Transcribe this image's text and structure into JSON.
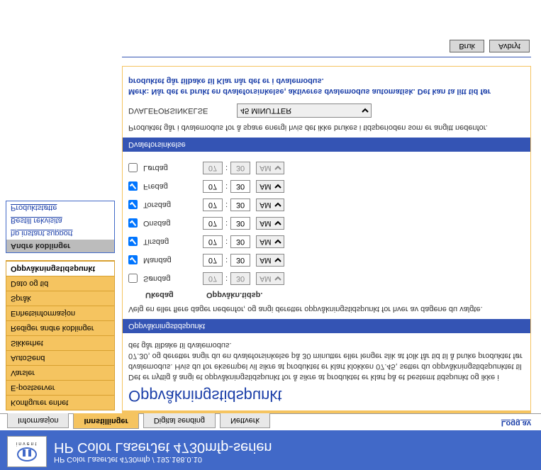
{
  "header": {
    "sub": "HP Color LaserJet 4730mfp / 192.168.0.10",
    "main": "HP Color LaserJet 4730mfp-serien",
    "logo_invent": "invent"
  },
  "tabs": {
    "info": "Informasjon",
    "settings": "Innstillinger",
    "digital": "Digital sending",
    "network": "Nettverk",
    "logoff": "Logg av"
  },
  "nav": {
    "items": [
      "Konfigurer enhet",
      "E-postserver",
      "Varsler",
      "AutoSend",
      "Sikkerhet",
      "Rediger andre koblinger",
      "Enhetsinformasjon",
      "Språk",
      "Dato og tid",
      "Oppvåkningstidspunkt"
    ]
  },
  "links": {
    "head": "Andre koblinger",
    "a": "hp instant support",
    "b": "Bestill rekvisita",
    "c": "Produktstøtte"
  },
  "page": {
    "title": "Oppvåkningstidspunkt",
    "intro": "Det er nyttig å angi et oppvåkningstidspunkt for å sikre at produktet er klart på et bestemt tidspunkt og ikke i dvalemodus. Hvis du for eksempel vil sikre at produktet er klart klokken 07.45, setter du oppvåkningstidspunktet til 07.30, og deretter angir du en dvaleforsinkelse på 30 minutter eller lenger slik at folk får tid til å bruke produktet før det går tilbake til dvalemodus.",
    "section1": "Oppvåkningstidspunkt",
    "section1_text": "Velg en eller flere dager nedenfor, og angi deretter oppvåkningstidspunkt for hver av dagene du valgte.",
    "col_day": "Ukedag",
    "col_time": "Oppvåkn.tidsp.",
    "days": [
      {
        "name": "Søndag",
        "checked": false,
        "h": "07",
        "m": "30",
        "ap": "AM"
      },
      {
        "name": "Mandag",
        "checked": true,
        "h": "07",
        "m": "30",
        "ap": "AM"
      },
      {
        "name": "Tirsdag",
        "checked": true,
        "h": "07",
        "m": "30",
        "ap": "AM"
      },
      {
        "name": "Onsdag",
        "checked": true,
        "h": "07",
        "m": "30",
        "ap": "AM"
      },
      {
        "name": "Torsdag",
        "checked": true,
        "h": "07",
        "m": "30",
        "ap": "AM"
      },
      {
        "name": "Fredag",
        "checked": true,
        "h": "07",
        "m": "30",
        "ap": "AM"
      },
      {
        "name": "Lørdag",
        "checked": false,
        "h": "07",
        "m": "30",
        "ap": "AM"
      }
    ],
    "section2": "Dvaleforsinkelse",
    "section2_text": "Produktet går i dvalemodus for å spare energi hvis det ikke brukes i tidsperioden som er angitt nedenfor.",
    "delay_label": "DVALEFORSINKELSE",
    "delay_value": "45 MINUTTER",
    "note": "Merk: Når det er brukt en dvaleforsinkelse, aktiveres dvalemodus automatisk. Det kan ta litt tid før produktet går tilbake til Klar når det er i dvalemodus.",
    "apply": "Bruk",
    "cancel": "Avbryt"
  }
}
